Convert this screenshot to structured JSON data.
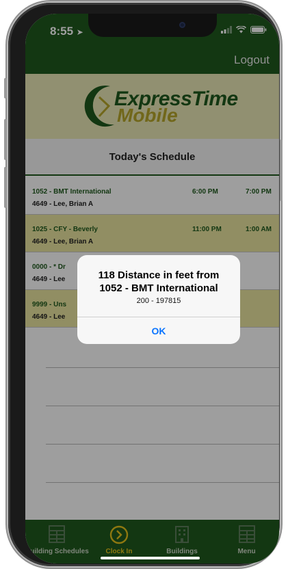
{
  "status_bar": {
    "time": "8:55"
  },
  "header": {
    "logout_label": "Logout"
  },
  "banner": {
    "logo_line1": "ExpressTime",
    "logo_line2": "Mobile"
  },
  "schedule": {
    "title": "Today's Schedule",
    "rows": [
      {
        "building": "1052 - BMT International",
        "employee": "4649 - Lee, Brian A",
        "start": "6:00 PM",
        "end": "7:00 PM"
      },
      {
        "building": "1025 - CFY - Beverly",
        "employee": "4649 - Lee, Brian A",
        "start": "11:00 PM",
        "end": "1:00 AM"
      },
      {
        "building": "0000 - * Dr",
        "employee": "4649 - Lee",
        "start": "",
        "end": ""
      },
      {
        "building": "9999 - Uns",
        "employee": "4649 - Lee",
        "start": "",
        "end": ""
      }
    ]
  },
  "alert": {
    "title_line1": "118 Distance in feet from",
    "title_line2": "1052 - BMT International",
    "message": "200 - 197815",
    "ok_label": "OK"
  },
  "tabbar": {
    "items": [
      {
        "label": "Building Schedules",
        "icon": "grid-icon"
      },
      {
        "label": "Clock In",
        "icon": "chevron-circle-icon",
        "active": true
      },
      {
        "label": "Buildings",
        "icon": "building-icon"
      },
      {
        "label": "Menu",
        "icon": "menu-grid-icon"
      }
    ]
  },
  "colors": {
    "primary_green": "#1f5a1e",
    "banner_yellow": "#ebe8b6",
    "row_alt": "#ebe5a0",
    "active_tab": "#e6c21a",
    "ios_blue": "#0a74ff"
  }
}
